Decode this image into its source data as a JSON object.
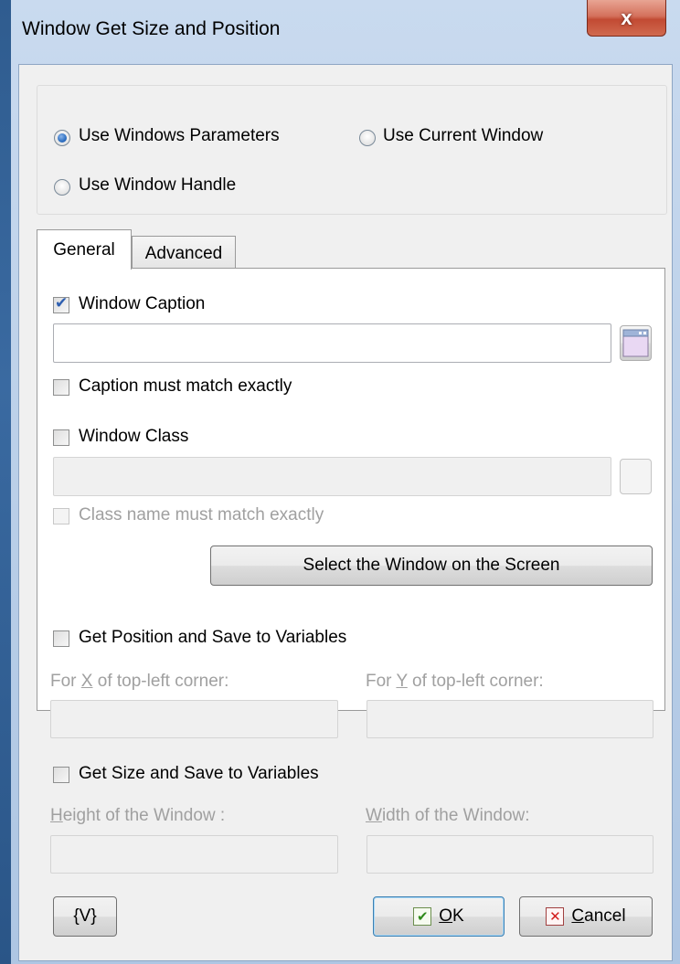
{
  "window": {
    "title": "Window Get Size and Position",
    "close_glyph": "x"
  },
  "mode": {
    "options": [
      {
        "label": "Use Windows Parameters",
        "checked": true
      },
      {
        "label": "Use Current Window",
        "checked": false
      },
      {
        "label": "Use Window Handle",
        "checked": false
      }
    ]
  },
  "tabs": [
    {
      "label": "General",
      "active": true
    },
    {
      "label": "Advanced",
      "active": false
    }
  ],
  "general": {
    "window_caption": {
      "label": "Window Caption",
      "checked": true,
      "value": ""
    },
    "caption_exact": {
      "label": "Caption must match exactly",
      "checked": false
    },
    "window_class": {
      "label": "Window Class",
      "checked": false,
      "value": ""
    },
    "class_exact": {
      "label": "Class name must match exactly",
      "checked": false
    },
    "select_button": "Select the Window on the Screen",
    "picker_icon": "window-picker-icon"
  },
  "position": {
    "label": "Get Position and Save to Variables",
    "checked": false,
    "x_label_pre": "For ",
    "x_label_key": "X",
    "x_label_post": " of top-left corner:",
    "y_label_pre": "For ",
    "y_label_key": "Y",
    "y_label_post": " of top-left corner:",
    "x_value": "",
    "y_value": ""
  },
  "size": {
    "label": "Get Size and Save to Variables",
    "checked": false,
    "height_label_key": "H",
    "height_label_rest": "eight of the Window :",
    "width_label_key": "W",
    "width_label_rest": "idth of the Window:",
    "height_value": "",
    "width_value": ""
  },
  "footer": {
    "variables_button": "{V}",
    "ok_key": "O",
    "ok_rest": "K",
    "ok_icon": "check-icon",
    "cancel_key": "C",
    "cancel_rest": "ancel",
    "cancel_icon": "x-icon"
  }
}
